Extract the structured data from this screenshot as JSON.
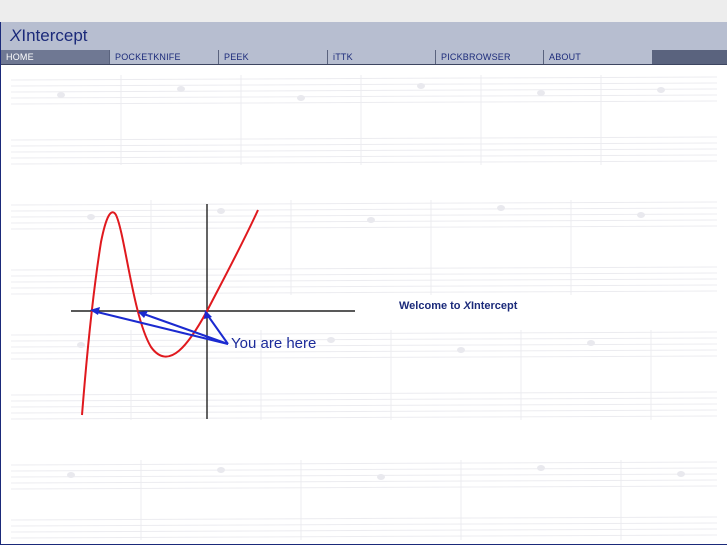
{
  "app": {
    "logo_prefix": "X",
    "logo_suffix": "Intercept"
  },
  "nav": {
    "items": [
      {
        "label": "HOME",
        "active": true
      },
      {
        "label": "POCKETKNIFE"
      },
      {
        "label": "PEEK"
      },
      {
        "label": "iTTK"
      },
      {
        "label": "PICKBROWSER"
      },
      {
        "label": "ABOUT"
      }
    ]
  },
  "main": {
    "welcome_prefix": "Welcome to ",
    "welcome_x": "X",
    "welcome_suffix": "Intercept",
    "graph_annotation": "You are here"
  },
  "colors": {
    "brand": "#1b2a7a",
    "curve": "#e0191e",
    "arrows": "#1b2ad0",
    "header": "#b7bed0",
    "nav_bar": "#5a637e"
  }
}
